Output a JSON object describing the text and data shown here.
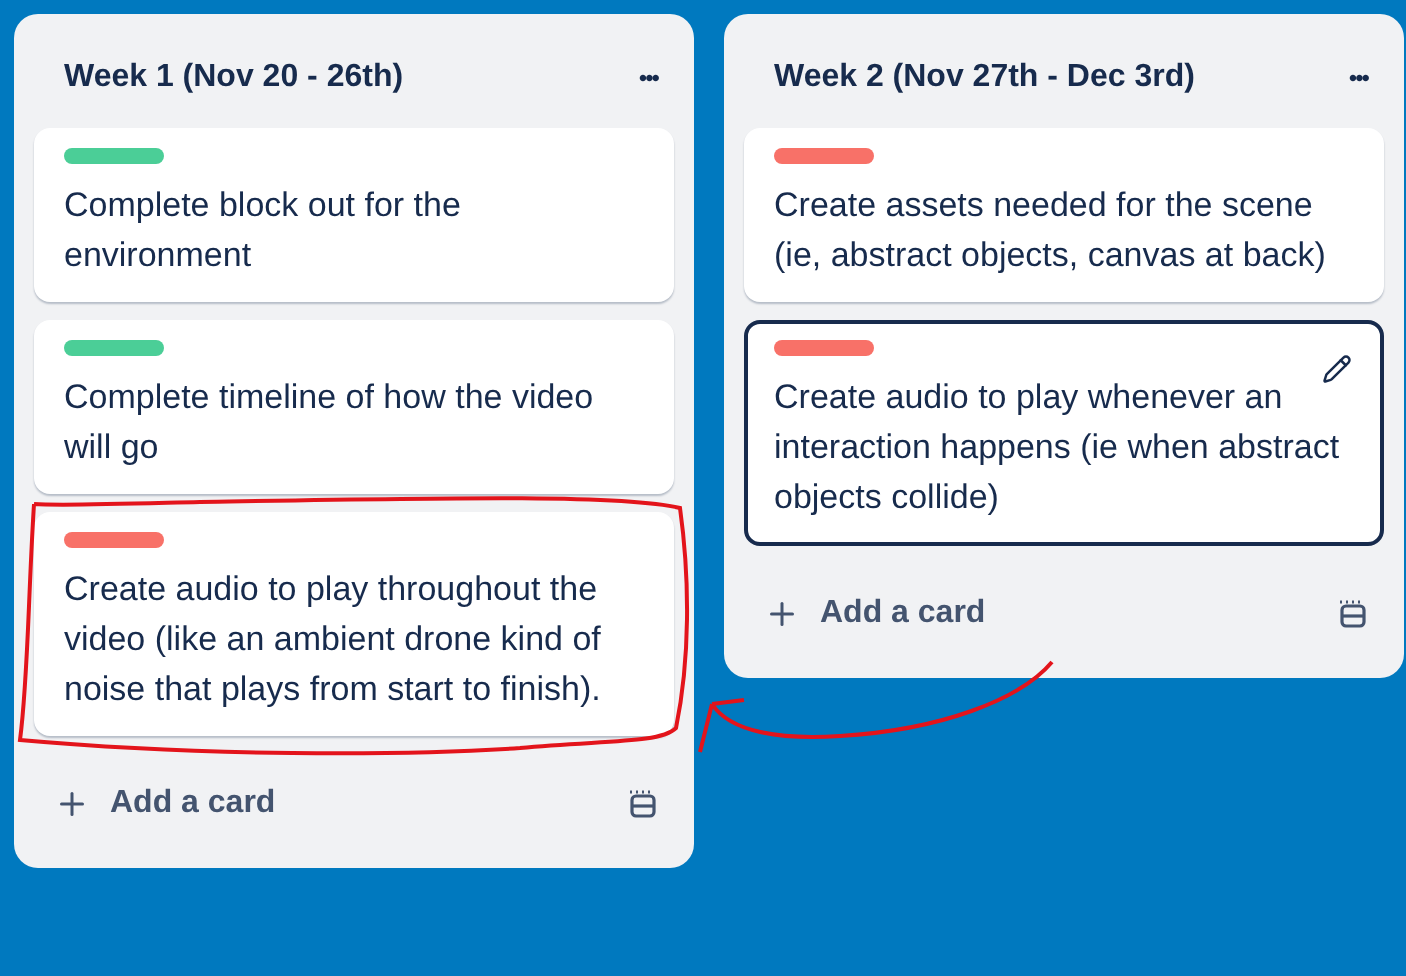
{
  "lists": [
    {
      "title": "Week 1 (Nov 20 - 26th)",
      "menu": "•••",
      "add_card": "Add a card",
      "cards": [
        {
          "color": "#4bce97",
          "text": "Complete block out for the environment",
          "focused": false
        },
        {
          "color": "#4bce97",
          "text": "Complete timeline of how the video will go",
          "focused": false
        },
        {
          "color": "#f87168",
          "text": "Create audio to play throughout the video (like an ambient drone kind of noise that plays from start to finish).",
          "focused": false
        }
      ]
    },
    {
      "title": "Week 2 (Nov 27th - Dec 3rd)",
      "menu": "•••",
      "add_card": "Add a card",
      "cards": [
        {
          "color": "#f87168",
          "text": "Create assets needed for the scene (ie, abstract objects, canvas at back)",
          "focused": false
        },
        {
          "color": "#f87168",
          "text": "Create audio to play whenever an interaction happens (ie when abstract objects collide)",
          "focused": true
        }
      ]
    }
  ]
}
